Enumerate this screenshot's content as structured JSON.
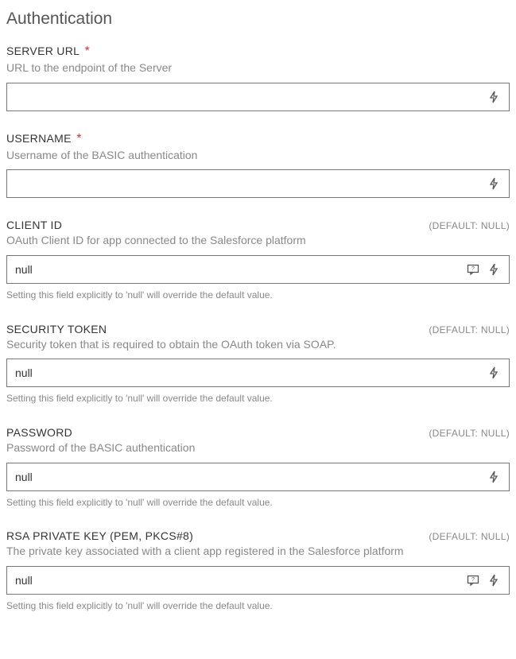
{
  "section": {
    "title": "Authentication"
  },
  "fields": {
    "serverUrl": {
      "label": "SERVER URL",
      "required": true,
      "description": "URL to the endpoint of the Server",
      "value": "",
      "defaultHint": "",
      "note": "",
      "hasCommentIcon": false
    },
    "username": {
      "label": "USERNAME",
      "required": true,
      "description": "Username of the BASIC authentication",
      "value": "",
      "defaultHint": "",
      "note": "",
      "hasCommentIcon": false
    },
    "clientId": {
      "label": "CLIENT ID",
      "required": false,
      "description": "OAuth Client ID for app connected to the Salesforce platform",
      "value": "null",
      "defaultHint": "(DEFAULT: NULL)",
      "note": "Setting this field explicitly to 'null' will override the default value.",
      "hasCommentIcon": true
    },
    "securityToken": {
      "label": "SECURITY TOKEN",
      "required": false,
      "description": "Security token that is required to obtain the OAuth token via SOAP.",
      "value": "null",
      "defaultHint": "(DEFAULT: NULL)",
      "note": "Setting this field explicitly to 'null' will override the default value.",
      "hasCommentIcon": false
    },
    "password": {
      "label": "PASSWORD",
      "required": false,
      "description": "Password of the BASIC authentication",
      "value": "null",
      "defaultHint": "(DEFAULT: NULL)",
      "note": "Setting this field explicitly to 'null' will override the default value.",
      "hasCommentIcon": false
    },
    "rsaPrivateKey": {
      "label": "RSA PRIVATE KEY (PEM, PKCS#8)",
      "required": false,
      "description": "The private key associated with a client app registered in the Salesforce platform",
      "value": "null",
      "defaultHint": "(DEFAULT: NULL)",
      "note": "Setting this field explicitly to 'null' will override the default value.",
      "hasCommentIcon": true
    }
  },
  "common": {
    "requiredMark": "*"
  }
}
